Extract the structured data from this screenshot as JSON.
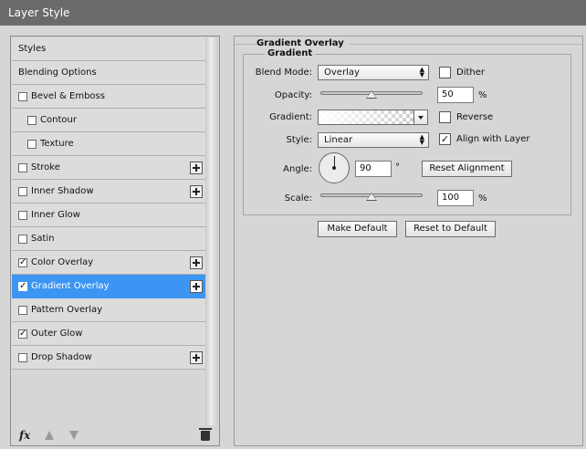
{
  "window": {
    "title": "Layer Style"
  },
  "styles_list": [
    {
      "label": "Styles",
      "checkbox": false,
      "checked": false,
      "plus": false,
      "indent": false,
      "selected": false
    },
    {
      "label": "Blending Options",
      "checkbox": false,
      "checked": false,
      "plus": false,
      "indent": false,
      "selected": false
    },
    {
      "label": "Bevel & Emboss",
      "checkbox": true,
      "checked": false,
      "plus": false,
      "indent": false,
      "selected": false
    },
    {
      "label": "Contour",
      "checkbox": true,
      "checked": false,
      "plus": false,
      "indent": true,
      "selected": false
    },
    {
      "label": "Texture",
      "checkbox": true,
      "checked": false,
      "plus": false,
      "indent": true,
      "selected": false
    },
    {
      "label": "Stroke",
      "checkbox": true,
      "checked": false,
      "plus": true,
      "indent": false,
      "selected": false
    },
    {
      "label": "Inner Shadow",
      "checkbox": true,
      "checked": false,
      "plus": true,
      "indent": false,
      "selected": false
    },
    {
      "label": "Inner Glow",
      "checkbox": true,
      "checked": false,
      "plus": false,
      "indent": false,
      "selected": false
    },
    {
      "label": "Satin",
      "checkbox": true,
      "checked": false,
      "plus": false,
      "indent": false,
      "selected": false
    },
    {
      "label": "Color Overlay",
      "checkbox": true,
      "checked": true,
      "plus": true,
      "indent": false,
      "selected": false
    },
    {
      "label": "Gradient Overlay",
      "checkbox": true,
      "checked": true,
      "plus": true,
      "indent": false,
      "selected": true
    },
    {
      "label": "Pattern Overlay",
      "checkbox": true,
      "checked": false,
      "plus": false,
      "indent": false,
      "selected": false
    },
    {
      "label": "Outer Glow",
      "checkbox": true,
      "checked": true,
      "plus": false,
      "indent": false,
      "selected": false
    },
    {
      "label": "Drop Shadow",
      "checkbox": true,
      "checked": false,
      "plus": true,
      "indent": false,
      "selected": false
    }
  ],
  "footer": {
    "fx_label": "fx",
    "icons": [
      "fx-icon",
      "move-up-icon",
      "move-down-icon",
      "trash-icon"
    ]
  },
  "panel": {
    "section_title": "Gradient Overlay",
    "group_title": "Gradient",
    "blend_mode": {
      "label": "Blend Mode:",
      "value": "Overlay"
    },
    "dither": {
      "label": "Dither",
      "checked": false
    },
    "opacity": {
      "label": "Opacity:",
      "value": "50",
      "unit": "%",
      "slider_fraction": 0.5
    },
    "gradient": {
      "label": "Gradient:"
    },
    "reverse": {
      "label": "Reverse",
      "checked": false
    },
    "style": {
      "label": "Style:",
      "value": "Linear"
    },
    "align": {
      "label": "Align with Layer",
      "checked": true
    },
    "angle": {
      "label": "Angle:",
      "value": "90",
      "unit": "°"
    },
    "reset_alignment": "Reset Alignment",
    "scale": {
      "label": "Scale:",
      "value": "100",
      "unit": "%",
      "slider_fraction": 0.5
    },
    "make_default": "Make Default",
    "reset_default": "Reset to Default"
  },
  "colors": {
    "selected_row": "#3c95f3",
    "titlebar": "#6a6a6a",
    "background": "#d6d6d6"
  }
}
